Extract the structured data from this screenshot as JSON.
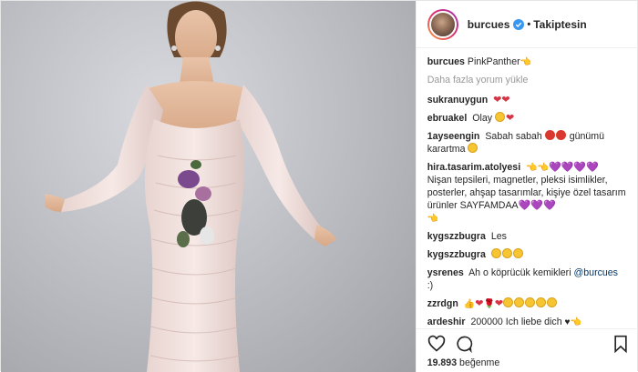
{
  "post": {
    "author": "burcues",
    "follow_status": "Takiptesin",
    "separator": "•",
    "caption_user": "burcues",
    "caption_text": "PinkPanther"
  },
  "load_more": "Daha fazla yorum yükle",
  "comments": [
    {
      "user": "sukranuygun",
      "text": ""
    },
    {
      "user": "ebruakel",
      "text": "Olay"
    },
    {
      "user": "1ayseengin",
      "text": "Sabah sabah",
      "text2": "günümü karartma"
    },
    {
      "user": "hira.tasarim.atolyesi",
      "text": "Nişan tepsileri, magnetler, pleksi isimlikler, posterler, ahşap tasarımlar, kişiye özel tasarım ürünler SAYFAMDAA"
    },
    {
      "user": "kygszzbugra",
      "text": "Les"
    },
    {
      "user": "kygszzbugra",
      "text": ""
    },
    {
      "user": "ysrenes",
      "text": "Ah o köprücük kemikleri",
      "mention": "@burcues",
      "text2": ":)"
    },
    {
      "user": "zzrdgn",
      "text": ""
    },
    {
      "user": "ardeshir",
      "text": "200000 Ich liebe dich"
    }
  ],
  "likes": {
    "count": "19.893",
    "label": "beğenme"
  },
  "icons": {
    "like": "heart-outline-icon",
    "comment": "comment-bubble-icon",
    "save": "bookmark-icon",
    "verified": "verified-badge-icon"
  },
  "colors": {
    "text": "#262626",
    "muted": "#999999",
    "verified_blue": "#3897f0",
    "mention": "#003569"
  }
}
